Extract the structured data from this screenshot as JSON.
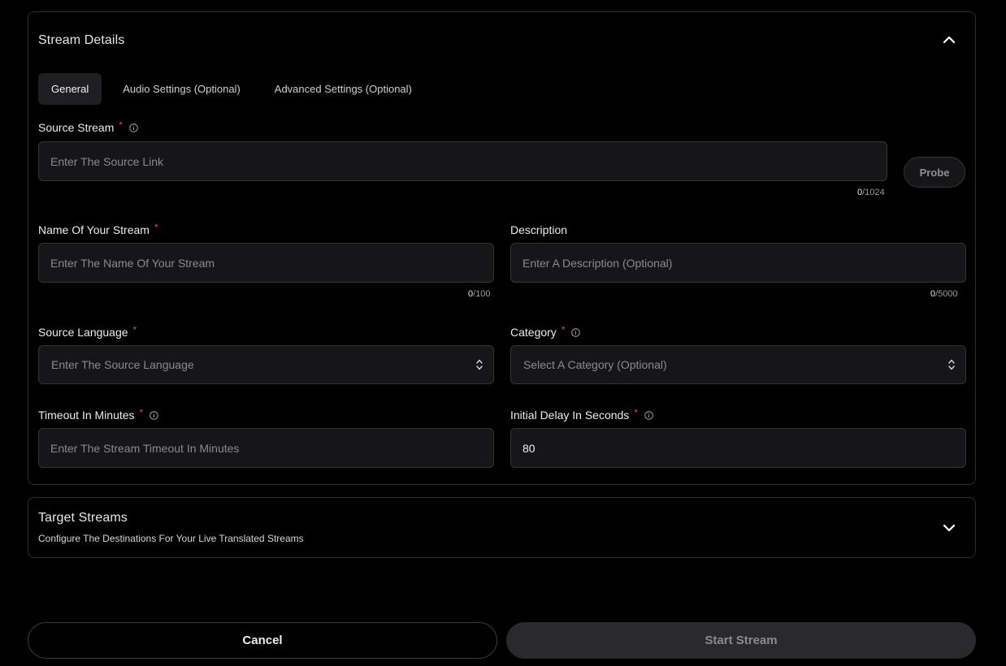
{
  "details": {
    "title": "Stream Details",
    "tabs": [
      {
        "label": "General",
        "active": true
      },
      {
        "label": "Audio Settings (Optional)",
        "active": false
      },
      {
        "label": "Advanced Settings (Optional)",
        "active": false
      }
    ],
    "source_stream": {
      "label": "Source Stream",
      "required_mark": "*",
      "placeholder": "Enter The Source Link",
      "value": "",
      "count": "0",
      "max": "/1024"
    },
    "probe_label": "Probe",
    "stream_name": {
      "label": "Name Of Your Stream",
      "required_mark": "*",
      "placeholder": "Enter The Name Of Your Stream",
      "value": "",
      "count": "0",
      "max": "/100"
    },
    "description": {
      "label": "Description",
      "placeholder": "Enter A Description (Optional)",
      "value": "",
      "count": "0",
      "max": "/5000"
    },
    "source_language": {
      "label": "Source Language",
      "required_mark": "*",
      "selected": "Enter The Source Language"
    },
    "category": {
      "label": "Category",
      "required_mark": "*",
      "selected": "Select A Category (Optional)"
    },
    "timeout": {
      "label": "Timeout In Minutes",
      "required_mark": "*",
      "placeholder": "Enter The Stream Timeout In Minutes",
      "value": ""
    },
    "initial_delay": {
      "label": "Initial Delay In Seconds",
      "required_mark": "*",
      "placeholder": "",
      "value": "80"
    }
  },
  "target": {
    "title": "Target Streams",
    "subtitle": "Configure The Destinations For Your Live Translated Streams"
  },
  "actions": {
    "cancel_label": "Cancel",
    "start_label": "Start Stream"
  },
  "icons": {
    "collapse": "chevron-up-icon",
    "expand": "chevron-down-icon",
    "info": "info-icon",
    "select": "updown-arrows-icon"
  },
  "colors": {
    "background": "#000000",
    "field_bg": "#161618",
    "border": "#333338",
    "required": "#e5484d",
    "start_button_bg": "#2a2a2d"
  }
}
